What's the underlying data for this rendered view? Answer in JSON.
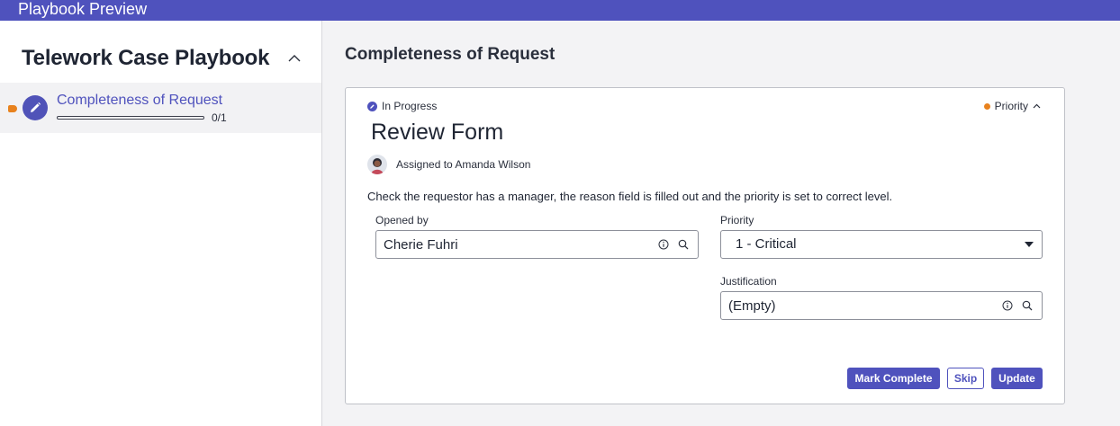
{
  "window": {
    "title": "Playbook Preview"
  },
  "sidebar": {
    "title": "Telework Case Playbook",
    "steps": [
      {
        "label": "Completeness of Request",
        "progress_text": "0/1",
        "progress": 0
      }
    ]
  },
  "main": {
    "title": "Completeness of Request",
    "card": {
      "status": "In Progress",
      "priority_label": "Priority",
      "task_title": "Review Form",
      "assignee_text": "Assigned to Amanda Wilson",
      "description": "Check the requestor has a manager, the reason field is filled out and the priority is set to correct level.",
      "fields": {
        "opened_by": {
          "label": "Opened by",
          "value": "Cherie Fuhri"
        },
        "priority": {
          "label": "Priority",
          "value": "1 - Critical"
        },
        "justification": {
          "label": "Justification",
          "value": "(Empty)"
        }
      },
      "buttons": {
        "mark_complete": "Mark Complete",
        "skip": "Skip",
        "update": "Update"
      }
    }
  },
  "colors": {
    "accent": "#4f52bd",
    "priority_dot": "#e8821e",
    "step_marker": "#e8821e"
  }
}
